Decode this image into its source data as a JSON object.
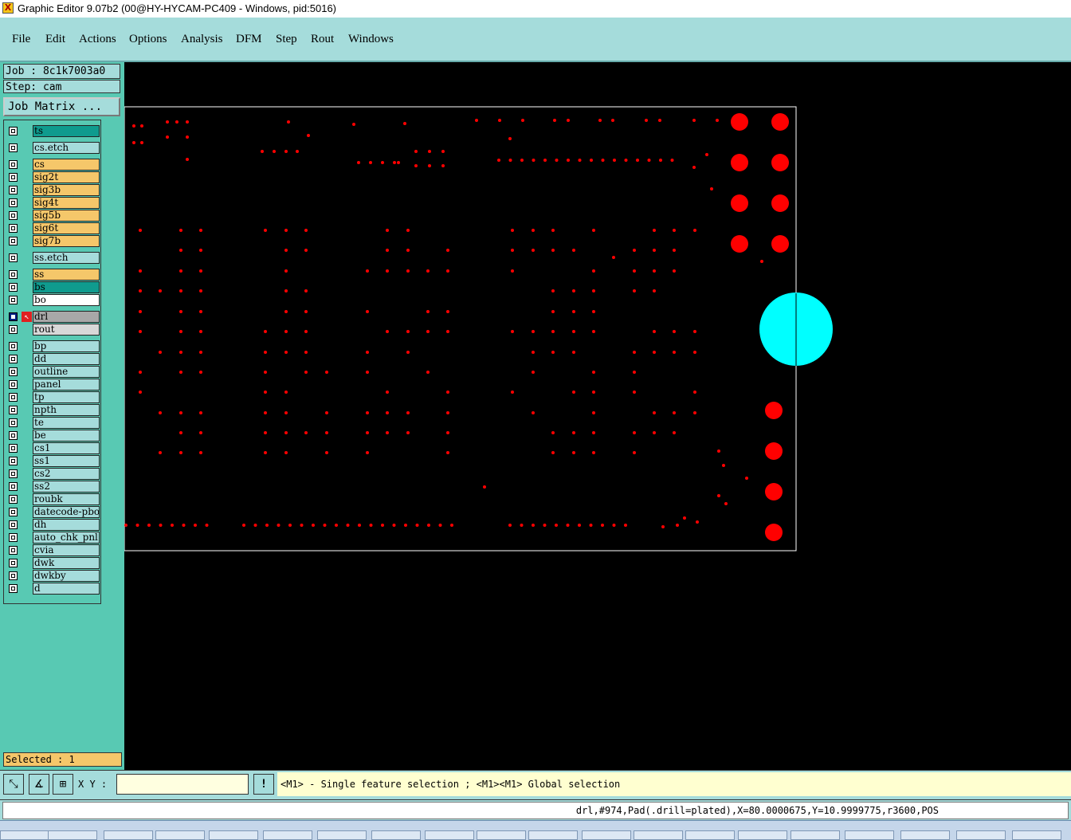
{
  "window": {
    "title": "Graphic Editor 9.07b2 (00@HY-HYCAM-PC409 - Windows, pid:5016)"
  },
  "menu": [
    {
      "label": "File"
    },
    {
      "label": "Edit"
    },
    {
      "label": "Actions"
    },
    {
      "label": "Options"
    },
    {
      "label": "Analysis"
    },
    {
      "label": "DFM"
    },
    {
      "label": "Step"
    },
    {
      "label": "Rout"
    },
    {
      "label": "Windows"
    }
  ],
  "job": {
    "label": "Job : 8c1k7003a0",
    "step_label": "Step: cam",
    "matrix_button": "Job Matrix ..."
  },
  "layers": [
    {
      "name": "ts",
      "color": "#0f9b8e"
    },
    {
      "name": "cs.etch",
      "color": "#a5dcdb"
    },
    {
      "name": "cs",
      "color": "#f5c76a"
    },
    {
      "name": "sig2t",
      "color": "#f5c76a"
    },
    {
      "name": "sig3b",
      "color": "#f5c76a"
    },
    {
      "name": "sig4t",
      "color": "#f5c76a"
    },
    {
      "name": "sig5b",
      "color": "#f5c76a"
    },
    {
      "name": "sig6t",
      "color": "#f5c76a"
    },
    {
      "name": "sig7b",
      "color": "#f5c76a"
    },
    {
      "name": "ss.etch",
      "color": "#a5dcdb"
    },
    {
      "name": "ss",
      "color": "#f5c76a"
    },
    {
      "name": "bs",
      "color": "#0f9b8e"
    },
    {
      "name": "bo",
      "color": "#ffffff"
    },
    {
      "name": "drl",
      "color": "#a8a8a8",
      "selected": true
    },
    {
      "name": "rout",
      "color": "#d8d8d8"
    },
    {
      "name": "bp",
      "color": "#a5dcdb"
    },
    {
      "name": "dd",
      "color": "#a5dcdb"
    },
    {
      "name": "outline",
      "color": "#a5dcdb"
    },
    {
      "name": "panel",
      "color": "#a5dcdb"
    },
    {
      "name": "tp",
      "color": "#a5dcdb"
    },
    {
      "name": "npth",
      "color": "#a5dcdb"
    },
    {
      "name": "te",
      "color": "#a5dcdb"
    },
    {
      "name": "be",
      "color": "#a5dcdb"
    },
    {
      "name": "cs1",
      "color": "#a5dcdb"
    },
    {
      "name": "ss1",
      "color": "#a5dcdb"
    },
    {
      "name": "cs2",
      "color": "#a5dcdb"
    },
    {
      "name": "ss2",
      "color": "#a5dcdb"
    },
    {
      "name": "roubk",
      "color": "#a5dcdb"
    },
    {
      "name": "datecode-pbo",
      "color": "#a5dcdb"
    },
    {
      "name": "dh",
      "color": "#a5dcdb"
    },
    {
      "name": "auto_chk_pnl",
      "color": "#a5dcdb"
    },
    {
      "name": "cvia",
      "color": "#a5dcdb"
    },
    {
      "name": "dwk",
      "color": "#a5dcdb"
    },
    {
      "name": "dwkby",
      "color": "#a5dcdb"
    },
    {
      "name": "d",
      "color": "#a5dcdb"
    }
  ],
  "selected": {
    "label": "Selected : 1"
  },
  "bottom": {
    "xy_label": "X Y :",
    "xy_value": "",
    "hint": "<M1> - Single feature selection ; <M1><M1> Global selection",
    "info": "drl,#974,Pad(.drill=plated),X=80.0000675,Y=10.9999775,r3600,POS"
  },
  "colors": {
    "pad": "#ff0000",
    "highlight": "#00ffff",
    "board_outline": "#ffffff",
    "background": "#000000"
  }
}
